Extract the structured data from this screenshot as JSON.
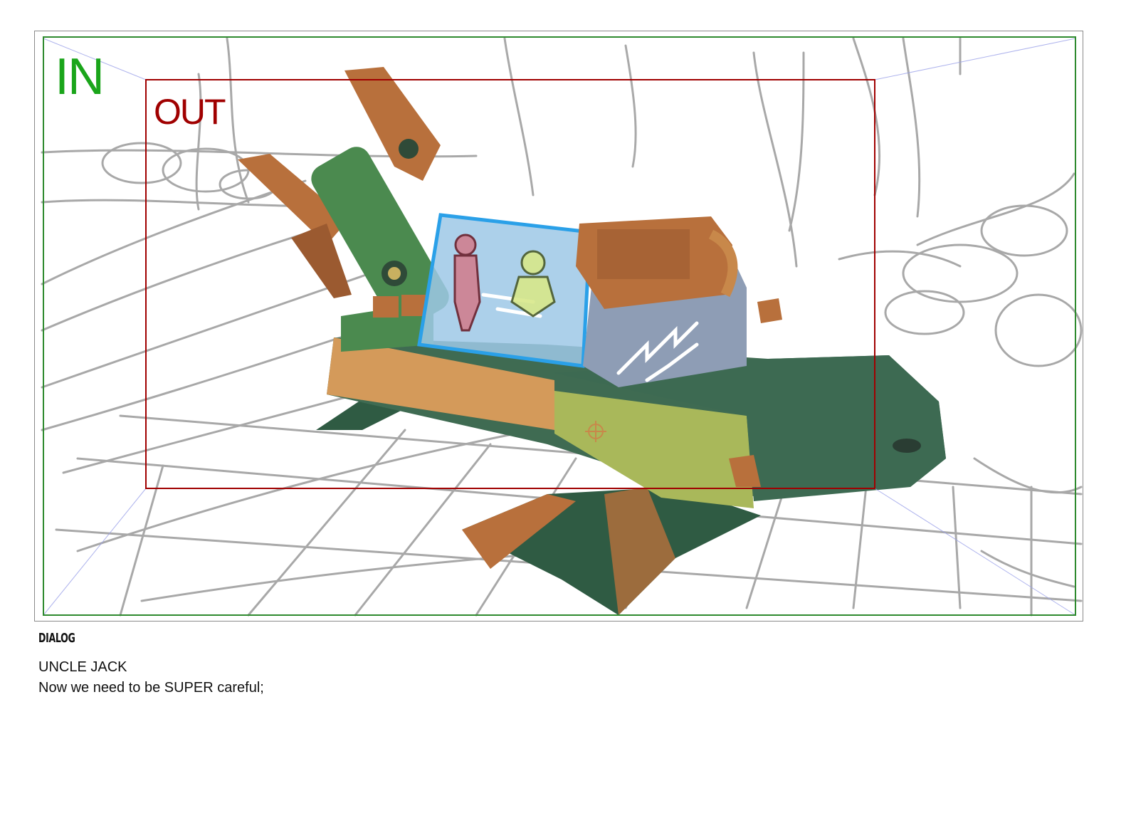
{
  "frame": {
    "in_label": "IN",
    "out_label": "OUT",
    "in_color": "#1aa51a",
    "out_color": "#a00000"
  },
  "subject": {
    "icon": "flying-fish-vehicle-illustration"
  },
  "dialog": {
    "heading": "DIALOG",
    "speaker": "UNCLE JACK",
    "line": "Now we need to be SUPER careful;"
  }
}
